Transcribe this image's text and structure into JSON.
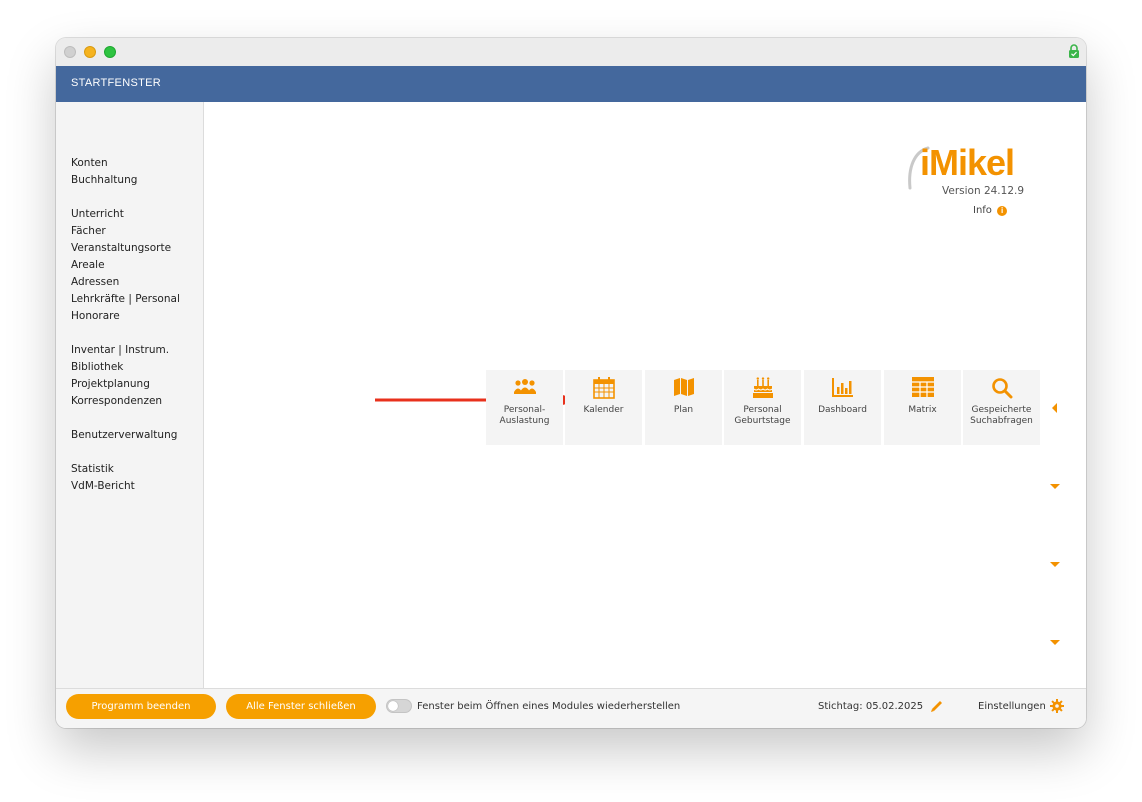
{
  "header": {
    "title": "STARTFENSTER"
  },
  "sidebar": {
    "groups": [
      [
        "Konten",
        "Buchhaltung"
      ],
      [
        "Unterricht",
        "Fächer",
        "Veranstaltungsorte",
        "Areale",
        "Adressen",
        "Lehrkräfte | Personal",
        "Honorare"
      ],
      [
        "Inventar | Instrum.",
        "Bibliothek",
        "Projektplanung",
        "Korrespondenzen"
      ],
      [
        "Benutzerverwaltung"
      ],
      [
        "Statistik",
        "VdM-Bericht"
      ]
    ]
  },
  "logo": {
    "brand": "iMikel",
    "version": "Version 24.12.9",
    "info_label": "Info",
    "info_badge": "i"
  },
  "modules": [
    {
      "label": "Personal-\nAuslastung",
      "icon": "people-group-icon"
    },
    {
      "label": "Kalender",
      "icon": "calendar-icon"
    },
    {
      "label": "Plan",
      "icon": "map-icon"
    },
    {
      "label": "Personal\nGeburtstage",
      "icon": "birthday-cake-icon"
    },
    {
      "label": "Dashboard",
      "icon": "bar-chart-icon"
    },
    {
      "label": "Matrix",
      "icon": "table-grid-icon"
    },
    {
      "label": "Gespeicherte\nSuchabfragen",
      "icon": "search-icon"
    }
  ],
  "footer": {
    "quit_label": "Programm beenden",
    "close_all_label": "Alle Fenster schließen",
    "restore_toggle_label": "Fenster beim Öffnen eines Modules wiederherstellen",
    "restore_toggle_on": false,
    "stichtag": "Stichtag: 05.02.2025",
    "settings_label": "Einstellungen"
  },
  "colors": {
    "accent": "#f39200",
    "header_bg": "#44689d",
    "arrow": "#e8311c",
    "button_bg": "#f6a000"
  }
}
